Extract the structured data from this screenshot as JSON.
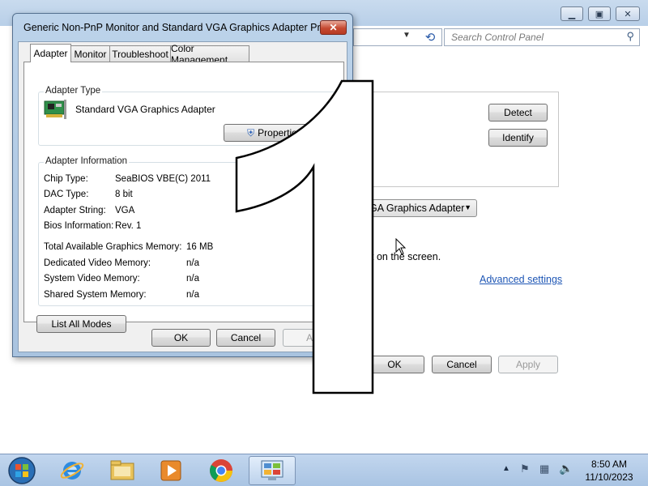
{
  "bg_window": {
    "search_placeholder": "Search Control Panel",
    "detect_label": "Detect",
    "identify_label": "Identify",
    "adapter_select": "GA Graphics Adapter",
    "screen_text": "t on the screen.",
    "advanced_link": "Advanced settings",
    "ok_label": "OK",
    "cancel_label": "Cancel",
    "apply_label": "Apply"
  },
  "dialog": {
    "title": "Generic Non-PnP Monitor and Standard VGA Graphics Adapter Pro...",
    "close_glyph": "✕",
    "tabs": [
      {
        "label": "Adapter"
      },
      {
        "label": "Monitor"
      },
      {
        "label": "Troubleshoot"
      },
      {
        "label": "Color Management"
      }
    ],
    "adapter_type": {
      "group_label": "Adapter Type",
      "name": "Standard VGA Graphics Adapter",
      "properties_label": "Properties"
    },
    "adapter_info": {
      "group_label": "Adapter Information",
      "rows": [
        {
          "label": "Chip Type:",
          "value": "SeaBIOS VBE(C) 2011"
        },
        {
          "label": "DAC Type:",
          "value": "8 bit"
        },
        {
          "label": "Adapter String:",
          "value": "VGA"
        },
        {
          "label": "Bios Information:",
          "value": "Rev. 1"
        }
      ],
      "memory": [
        {
          "label": "Total Available Graphics Memory:",
          "value": "16 MB"
        },
        {
          "label": "Dedicated Video Memory:",
          "value": "n/a"
        },
        {
          "label": "System Video Memory:",
          "value": "n/a"
        },
        {
          "label": "Shared System Memory:",
          "value": "n/a"
        }
      ]
    },
    "list_all_modes_label": "List All Modes",
    "ok_label": "OK",
    "cancel_label": "Cancel",
    "apply_label": "Ap"
  },
  "overlay": {
    "digit": "1"
  },
  "taskbar": {
    "time": "8:50 AM",
    "date": "11/10/2023"
  }
}
